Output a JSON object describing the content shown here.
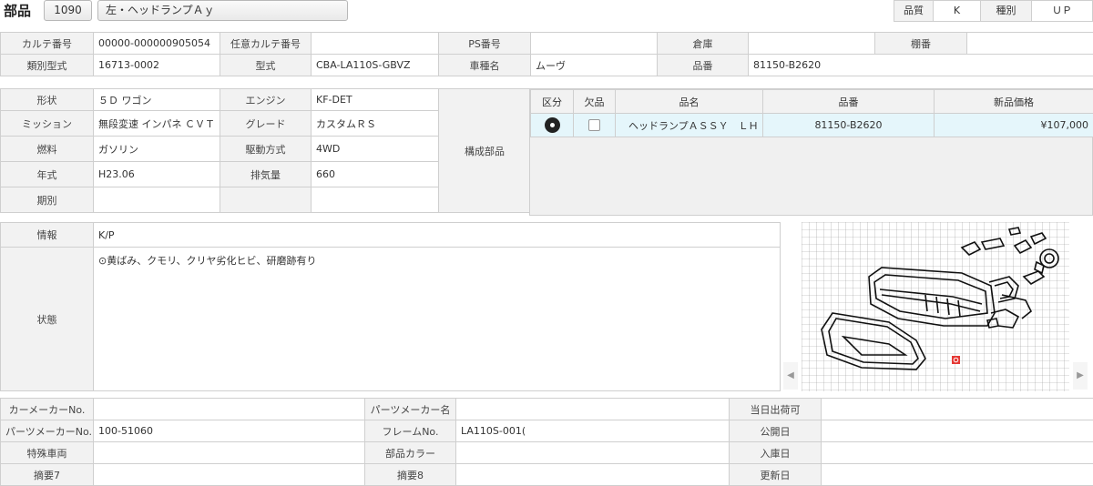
{
  "header": {
    "title": "部品",
    "code": "1090",
    "name_value": "左・ヘッドランプＡｙ",
    "quality_label": "品質",
    "quality_value": "K",
    "type_label": "種別",
    "type_value": "ＵＰ"
  },
  "row1": {
    "karte_no_label": "カルテ番号",
    "karte_no": "00000-000000905054",
    "opt_karte_label": "任意カルテ番号",
    "opt_karte": "",
    "ps_label": "PS番号",
    "ps": "",
    "warehouse_label": "倉庫",
    "warehouse": "",
    "shelf_label": "棚番",
    "shelf": ""
  },
  "row2": {
    "class_model_label": "類別型式",
    "class_model": "16713-0002",
    "model_label": "型式",
    "model": "CBA-LA110S-GBVZ",
    "car_name_label": "車種名",
    "car_name": "ムーヴ",
    "part_no_label": "品番",
    "part_no": "81150-B2620"
  },
  "spec": {
    "shape_label": "形状",
    "shape": "５Ｄ ワゴン",
    "engine_label": "エンジン",
    "engine": "KF-DET",
    "mission_label": "ミッション",
    "mission": "無段変速 インパネ ＣＶＴ",
    "grade_label": "グレード",
    "grade": "カスタムＲＳ",
    "fuel_label": "燃料",
    "fuel": "ガソリン",
    "drive_label": "駆動方式",
    "drive": "4WD",
    "year_label": "年式",
    "year": "H23.06",
    "displacement_label": "排気量",
    "displacement": "660",
    "period_label": "期別",
    "period": "",
    "components_label": "構成部品"
  },
  "parts_table": {
    "headers": [
      "区分",
      "欠品",
      "品名",
      "品番",
      "新品価格"
    ],
    "rows": [
      {
        "name": "ヘッドランプＡＳＳＹ　ＬＨ",
        "part_no": "81150-B2620",
        "price": "¥107,000"
      }
    ]
  },
  "info": {
    "info_label": "情報",
    "info": "K/P",
    "condition_label": "状態",
    "condition": "⊙黄ばみ、クモリ、クリヤ劣化ヒビ、研磨跡有り"
  },
  "bottom": {
    "car_maker_no_label": "カーメーカーNo.",
    "car_maker_no": "",
    "parts_maker_name_label": "パーツメーカー名",
    "parts_maker_name": "",
    "ship_today_label": "当日出荷可",
    "ship_today": "",
    "parts_maker_no_label": "パーツメーカーNo.",
    "parts_maker_no": "100-51060",
    "frame_label": "フレームNo.",
    "frame": "LA110S-001(",
    "publish_label": "公開日",
    "publish": "",
    "special_label": "特殊車両",
    "special": "",
    "color_label": "部品カラー",
    "color": "",
    "stock_in_label": "入庫日",
    "stock_in": "",
    "note7_label": "摘要7",
    "note8_label": "摘要8",
    "update_label": "更新日"
  },
  "icons": {
    "category_icon": "disc-icon",
    "scroll_left": "chevron-left-icon",
    "scroll_right": "chevron-right-icon"
  },
  "colors": {
    "label_bg": "#f2f2f2",
    "selected_row_bg": "#e5f6fb",
    "border": "#cfcfcf",
    "marker_red": "#e53935"
  }
}
